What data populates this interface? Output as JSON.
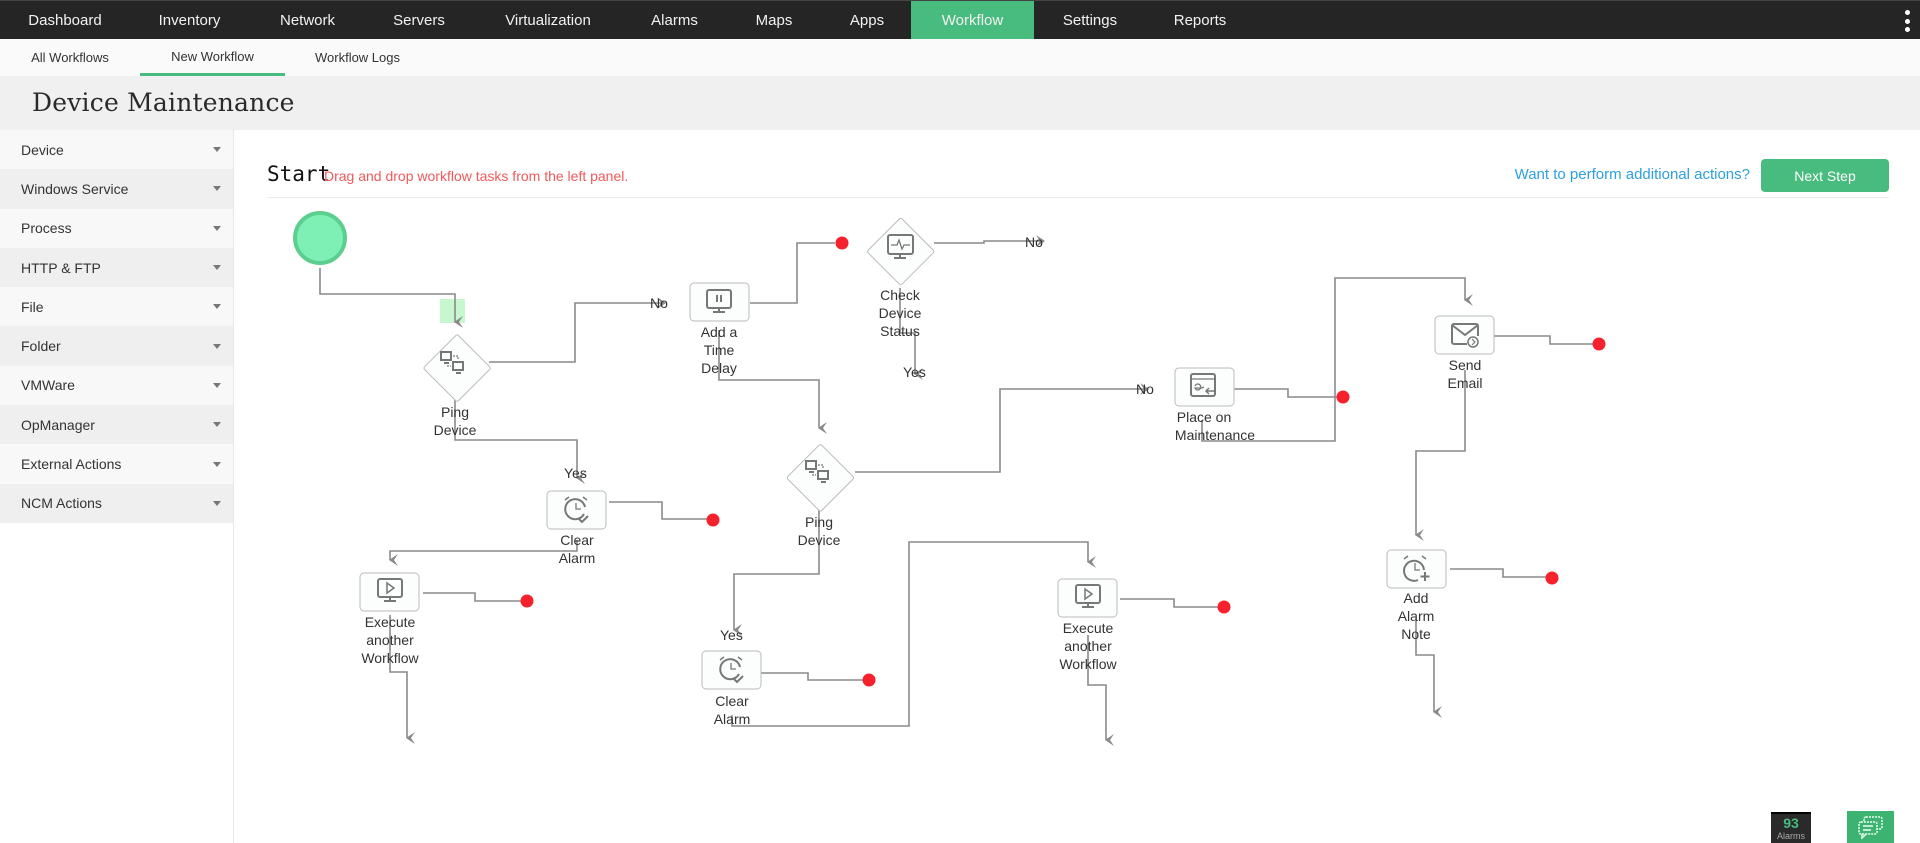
{
  "topnav": {
    "tabs": [
      {
        "label": "Dashboard"
      },
      {
        "label": "Inventory"
      },
      {
        "label": "Network"
      },
      {
        "label": "Servers"
      },
      {
        "label": "Virtualization"
      },
      {
        "label": "Alarms"
      },
      {
        "label": "Maps"
      },
      {
        "label": "Apps"
      },
      {
        "label": "Workflow",
        "active": true
      },
      {
        "label": "Settings"
      },
      {
        "label": "Reports"
      }
    ],
    "more_icon": "vertical-ellipsis-icon"
  },
  "subnav": {
    "tabs": [
      {
        "label": "All Workflows"
      },
      {
        "label": "New Workflow",
        "active": true
      },
      {
        "label": "Workflow Logs"
      }
    ]
  },
  "page": {
    "title": "Device Maintenance"
  },
  "sidebar": {
    "items": [
      {
        "label": "Device"
      },
      {
        "label": "Windows Service"
      },
      {
        "label": "Process"
      },
      {
        "label": "HTTP & FTP"
      },
      {
        "label": "File"
      },
      {
        "label": "Folder"
      },
      {
        "label": "VMWare"
      },
      {
        "label": "OpManager"
      },
      {
        "label": "External Actions"
      },
      {
        "label": "NCM Actions"
      }
    ]
  },
  "canvas": {
    "start_label": "Start",
    "hint": "Drag and drop workflow tasks from the left panel.",
    "more_actions_link": "Want to perform additional actions?",
    "next_button": "Next Step"
  },
  "workflow": {
    "nodes": [
      {
        "id": "ping1",
        "shape": "diamond",
        "icon": "ping-device-icon",
        "label": [
          "Ping",
          "Device"
        ]
      },
      {
        "id": "delay",
        "shape": "box",
        "icon": "time-delay-icon",
        "label": [
          "Add a",
          "Time",
          "Delay"
        ]
      },
      {
        "id": "check",
        "shape": "diamond",
        "icon": "check-device-status-icon",
        "label": [
          "Check",
          "Device",
          "Status"
        ]
      },
      {
        "id": "clear1",
        "shape": "box",
        "icon": "clear-alarm-icon",
        "label": [
          "Clear",
          "Alarm"
        ]
      },
      {
        "id": "exec1",
        "shape": "box",
        "icon": "execute-workflow-icon",
        "label": [
          "Execute",
          "another",
          "Workflow"
        ]
      },
      {
        "id": "ping2",
        "shape": "diamond",
        "icon": "ping-device-icon",
        "label": [
          "Ping",
          "Device"
        ]
      },
      {
        "id": "clear2",
        "shape": "box",
        "icon": "clear-alarm-icon",
        "label": [
          "Clear",
          "Alarm"
        ]
      },
      {
        "id": "exec2",
        "shape": "box",
        "icon": "execute-workflow-icon",
        "label": [
          "Execute",
          "another",
          "Workflow"
        ]
      },
      {
        "id": "maint",
        "shape": "box",
        "icon": "maintenance-icon",
        "label": [
          "Place on",
          "Maintenance"
        ]
      },
      {
        "id": "email",
        "shape": "box",
        "icon": "send-email-icon",
        "label": [
          "Send",
          "Email"
        ]
      },
      {
        "id": "note",
        "shape": "box",
        "icon": "add-alarm-note-icon",
        "label": [
          "Add",
          "Alarm",
          "Note"
        ]
      }
    ],
    "branch_labels": {
      "yes": "Yes",
      "no": "No"
    }
  },
  "footer": {
    "alarm_count": "93",
    "alarm_label": "Alarms",
    "chat_icon": "chat-icon"
  },
  "colors": {
    "accent": "#48bb7e",
    "start_node": "#7ff0b5",
    "end_dot": "#f5222d",
    "hint": "#f05a5a",
    "link": "#2e9fe0"
  }
}
